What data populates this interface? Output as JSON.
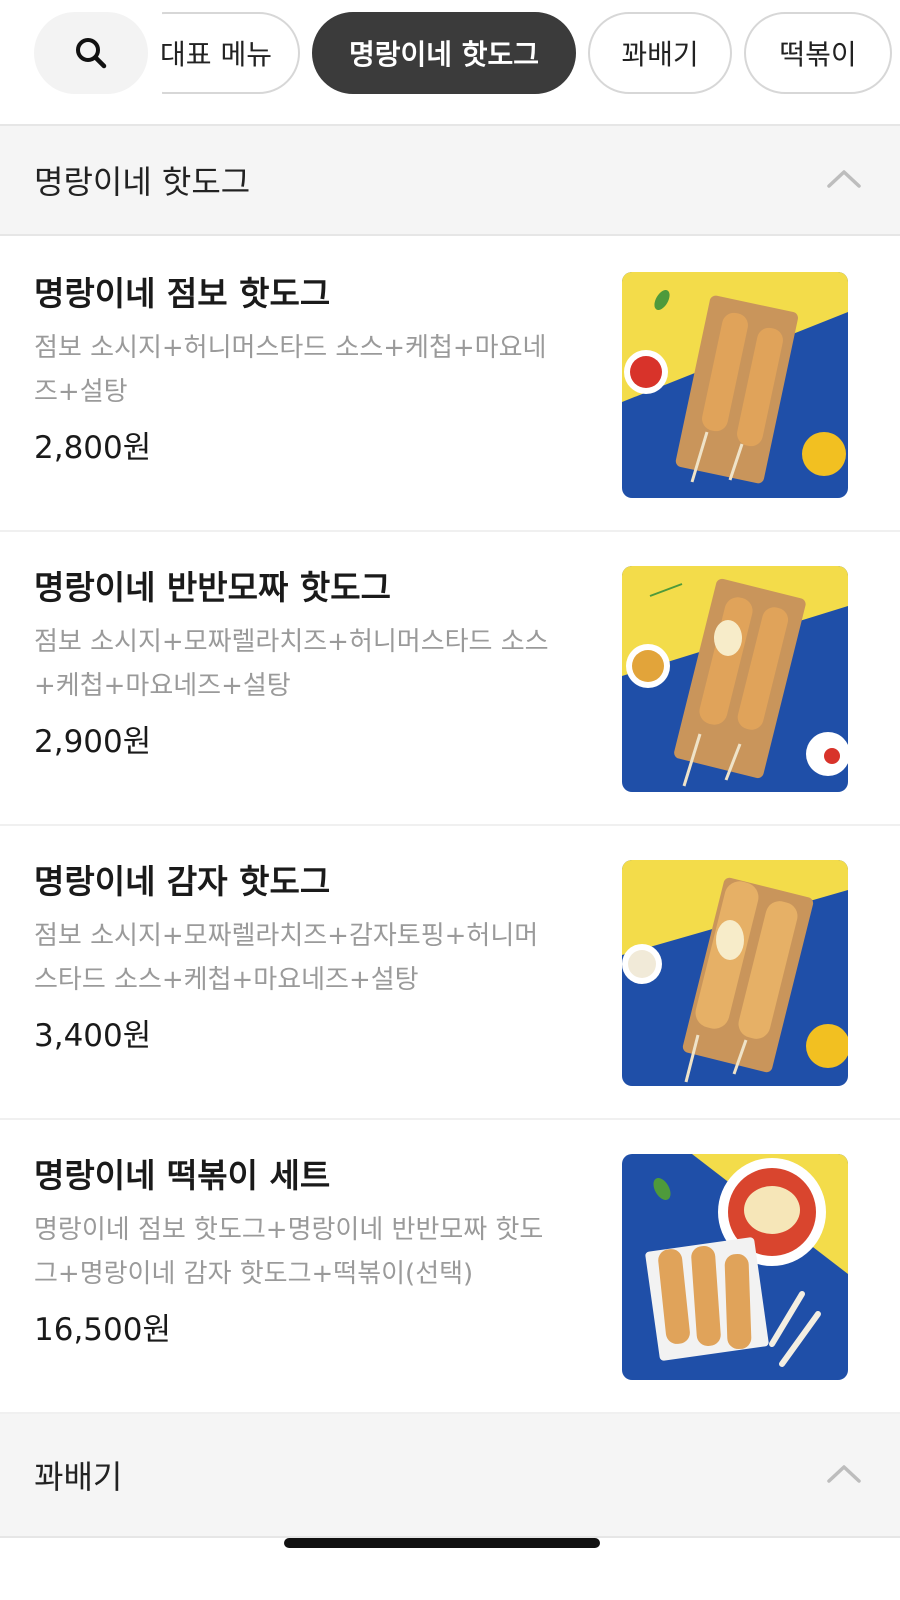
{
  "categories": {
    "search_icon": "search-icon",
    "chips": [
      {
        "label": "대표 메뉴"
      },
      {
        "label": "명랑이네 핫도그"
      },
      {
        "label": "꽈배기"
      },
      {
        "label": "떡볶이"
      }
    ],
    "active_index": 1
  },
  "sections": {
    "hotdog": {
      "title": "명랑이네 핫도그",
      "icon": "chevron-up-icon"
    },
    "twist": {
      "title": "꽈배기",
      "icon": "chevron-up-icon"
    }
  },
  "items": [
    {
      "name": "명랑이네 점보 핫도그",
      "desc_line1": "점보 소시지+허니머스타드 소스+케첩+마요네",
      "desc_line2": "즈+설탕",
      "price": "2,800원",
      "sauce_color": "#d8332a"
    },
    {
      "name": "명랑이네 반반모짜 핫도그",
      "desc_line1": "점보 소시지+모짜렐라치즈+허니머스타드 소스",
      "desc_line2": "+케첩+마요네즈+설탕",
      "price": "2,900원",
      "sauce_color": "#e2a43a"
    },
    {
      "name": "명랑이네 감자 핫도그",
      "desc_line1": "점보 소시지+모짜렐라치즈+감자토핑+허니머",
      "desc_line2": "스타드 소스+케첩+마요네즈+설탕",
      "price": "3,400원",
      "sauce_color": "#f1ead8"
    },
    {
      "name": "명랑이네 떡볶이 세트",
      "desc_line1": "명랑이네 점보 핫도그+명랑이네 반반모짜 핫도",
      "desc_line2": "그+명랑이네 감자 핫도그+떡볶이(선택)",
      "price": "16,500원",
      "sauce_color": "#d9452e"
    }
  ],
  "colors": {
    "active_chip": "#3b3b3b",
    "photo_blue": "#1f4fa8",
    "photo_yellow": "#f3dc4a"
  }
}
